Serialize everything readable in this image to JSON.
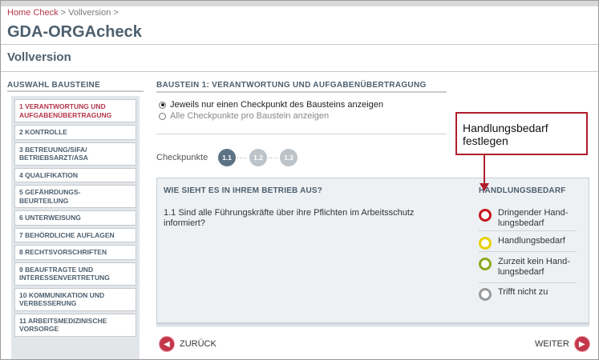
{
  "breadcrumb": {
    "home": "Home Check",
    "sep1": ">",
    "current": "Vollversion",
    "sep2": ">"
  },
  "page_title": "GDA-ORGAcheck",
  "sub_title": "Vollversion",
  "sidebar": {
    "heading": "AUSWAHL BAUSTEINE",
    "items": [
      {
        "label": "1 VERANTWORTUNG UND AUFGABENÜBERTRAGUNG",
        "active": true
      },
      {
        "label": "2 KONTROLLE"
      },
      {
        "label": "3 BETREUUNG/SIFA/ BETRIEBSARZT/ASA"
      },
      {
        "label": "4 QUALIFIKATION"
      },
      {
        "label": "5 GEFÄHRDUNGS- BEURTEILUNG"
      },
      {
        "label": "6 UNTERWEISUNG"
      },
      {
        "label": "7 BEHÖRDLICHE AUFLAGEN"
      },
      {
        "label": "8 RECHTSVORSCHRIFTEN"
      },
      {
        "label": "9 BEAUFTRAGTE UND INTERESSENVERTRETUNG"
      },
      {
        "label": "10 KOMMUNIKATION UND VERBESSERUNG"
      },
      {
        "label": "11 ARBEITSMEDIZINISCHE VORSORGE"
      }
    ]
  },
  "main": {
    "heading": "BAUSTEIN 1: VERANTWORTUNG UND AUFGABENÜBERTRAGUNG",
    "radio_options": [
      {
        "label": "Jeweils nur einen Checkpunkt des Bausteins anzeigen",
        "selected": true
      },
      {
        "label": "Alle Checkpunkte pro Baustein anzeigen",
        "selected": false
      }
    ],
    "checkpoints_label": "Checkpunkte",
    "checkpoints": [
      "1.1",
      "1.2",
      "1.3"
    ],
    "checkpoint_dots": "....",
    "active_checkpoint": "1.1"
  },
  "question_panel": {
    "heading": "WIE SIEHT ES IN IHREM BETRIEB AUS?",
    "question": "1.1 Sind alle Führungskräfte über ihre Pflichten im Arbeitsschutz informiert?"
  },
  "handlungsbedarf": {
    "heading": "HANDLUNGSBEDARF",
    "options": [
      {
        "label": "Dringender Hand-lungsbedarf",
        "color": "#c4161c"
      },
      {
        "label": "Handlungsbedarf",
        "color": "#e8d000"
      },
      {
        "label": "Zurzeit kein Hand-lungsbedarf",
        "color": "#8caa22"
      },
      {
        "label": "Trifft nicht zu",
        "color": "#9a9a9a"
      }
    ]
  },
  "nav": {
    "back_label": "ZURÜCK",
    "next_label": "WEITER"
  },
  "callout": {
    "text": "Handlungsbedarf festlegen",
    "color": "#b01d2c"
  },
  "colors": {
    "accent": "#b5354a",
    "heading": "#4d5f6e",
    "checkpoint_active": "#5c7285",
    "checkpoint_inactive": "#bcc3c9"
  }
}
